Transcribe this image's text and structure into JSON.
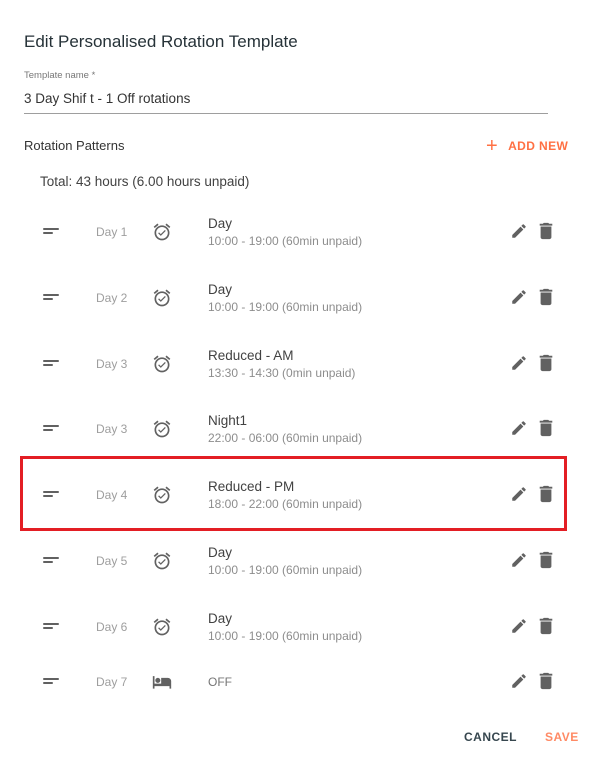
{
  "dialog": {
    "title": "Edit Personalised Rotation Template"
  },
  "template_field": {
    "label": "Template name *",
    "value": "3 Day Shif t - 1 Off rotations"
  },
  "rotation": {
    "title": "Rotation Patterns",
    "add_new_label": "ADD NEW",
    "total": "Total: 43 hours (6.00 hours unpaid)",
    "items": [
      {
        "day": "Day 1",
        "icon": "alarm-icon",
        "title": "Day",
        "time": "10:00 - 19:00 (60min unpaid)"
      },
      {
        "day": "Day 2",
        "icon": "alarm-icon",
        "title": "Day",
        "time": "10:00 - 19:00 (60min unpaid)"
      },
      {
        "day": "Day 3",
        "icon": "alarm-icon",
        "title": "Reduced - AM",
        "time": "13:30 - 14:30 (0min unpaid)"
      },
      {
        "day": "Day 3",
        "icon": "alarm-icon",
        "title": "Night1",
        "time": "22:00 - 06:00 (60min unpaid)"
      },
      {
        "day": "Day 4",
        "icon": "alarm-icon",
        "title": "Reduced - PM",
        "time": "18:00 - 22:00 (60min unpaid)",
        "highlighted": true
      },
      {
        "day": "Day 5",
        "icon": "alarm-icon",
        "title": "Day",
        "time": "10:00 - 19:00 (60min unpaid)"
      },
      {
        "day": "Day 6",
        "icon": "alarm-icon",
        "title": "Day",
        "time": "10:00 - 19:00 (60min unpaid)"
      },
      {
        "day": "Day 7",
        "icon": "bed-icon",
        "title": "OFF",
        "time": ""
      }
    ]
  },
  "actions": {
    "cancel_label": "CANCEL",
    "save_label": "SAVE"
  },
  "colors": {
    "accent": "#ff7043",
    "highlight": "#e31e24",
    "icon": "#616161"
  }
}
